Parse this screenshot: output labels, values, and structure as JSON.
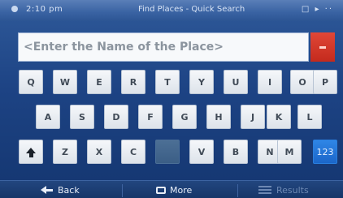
{
  "statusbar": {
    "time": "2:10 pm",
    "title": "Find Places - Quick Search",
    "right_icons": "□ ▸ ··"
  },
  "search": {
    "placeholder": "<Enter the Name of the Place>"
  },
  "keyboard": {
    "row1": [
      "Q",
      "W",
      "E",
      "R",
      "T",
      "Y",
      "U",
      "I",
      "O",
      "P"
    ],
    "row2": [
      "A",
      "S",
      "D",
      "F",
      "G",
      "H",
      "J",
      "K",
      "L"
    ],
    "row3": [
      "Z",
      "X",
      "C",
      "",
      "V",
      "B",
      "N",
      "M"
    ],
    "numeric_label": "123"
  },
  "bottombar": {
    "back_label": "Back",
    "more_label": "More",
    "results_label": "Results"
  },
  "colors": {
    "accent_red": "#c42a1d",
    "numeric_key_blue": "#1b66c9",
    "background": "#1b3e76"
  }
}
